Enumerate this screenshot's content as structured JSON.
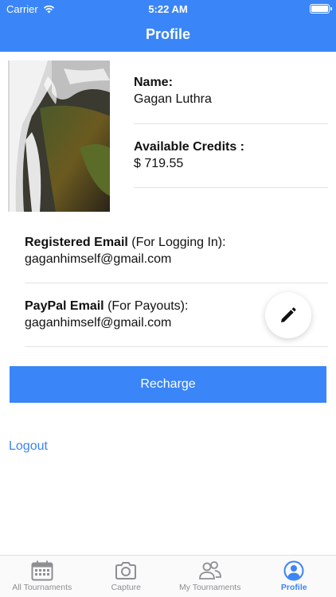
{
  "status_bar": {
    "carrier": "Carrier",
    "time": "5:22 AM"
  },
  "nav": {
    "title": "Profile"
  },
  "profile": {
    "name_label": "Name:",
    "name_value": "Gagan Luthra",
    "credits_label": "Available Credits :",
    "credits_value": "$ 719.55"
  },
  "registered_email": {
    "label_bold": "Registered Email",
    "label_note": " (For Logging In):",
    "value": "gaganhimself@gmail.com"
  },
  "paypal_email": {
    "label_bold": "PayPal Email",
    "label_note": " (For Payouts):",
    "value": "gaganhimself@gmail.com"
  },
  "actions": {
    "recharge": "Recharge",
    "logout": "Logout"
  },
  "tabs": [
    {
      "label": "All Tournaments",
      "icon": "calendar-icon"
    },
    {
      "label": "Capture",
      "icon": "camera-icon"
    },
    {
      "label": "My Tournaments",
      "icon": "people-icon"
    },
    {
      "label": "Profile",
      "icon": "profile-icon",
      "active": true
    }
  ],
  "colors": {
    "accent": "#3a85f7",
    "inactive": "#8e8e93"
  }
}
